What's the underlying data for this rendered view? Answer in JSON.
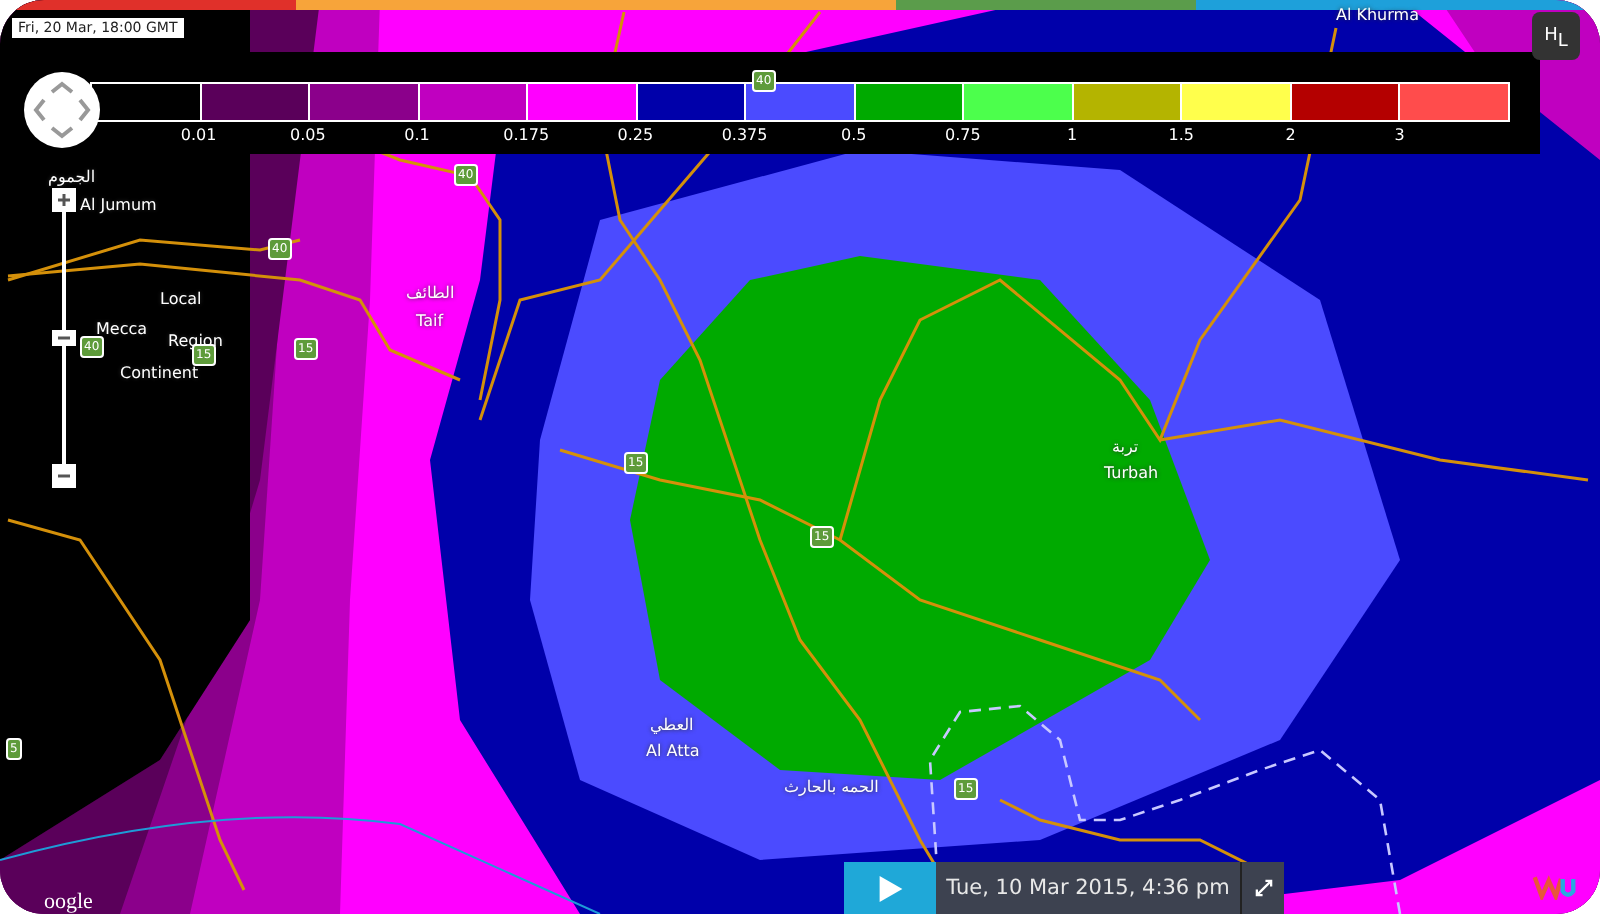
{
  "timestamp": "Fri, 20 Mar, 18:00 GMT",
  "legend": {
    "swatches": [
      {
        "color": "#000000"
      },
      {
        "color": "#5a005a"
      },
      {
        "color": "#8b008b"
      },
      {
        "color": "#c000c0"
      },
      {
        "color": "#ff00ff"
      },
      {
        "color": "#0000aa"
      },
      {
        "color": "#4b4bff"
      },
      {
        "color": "#00aa00"
      },
      {
        "color": "#4cff4c"
      },
      {
        "color": "#b4b400"
      },
      {
        "color": "#ffff4c"
      },
      {
        "color": "#b40000"
      },
      {
        "color": "#ff4c4c"
      }
    ],
    "labels": [
      "0.01",
      "0.05",
      "0.1",
      "0.175",
      "0.25",
      "0.375",
      "0.5",
      "0.75",
      "1",
      "1.5",
      "2",
      "3"
    ]
  },
  "place_labels": [
    {
      "text": "Al Khurma"
    },
    {
      "text": "الطائف"
    },
    {
      "text": "Taif"
    },
    {
      "text": "الجموم"
    },
    {
      "text": "Al Jumum"
    },
    {
      "text": "Local"
    },
    {
      "text": "Mecca"
    },
    {
      "text": "Region"
    },
    {
      "text": "Continent"
    },
    {
      "text": "تربة"
    },
    {
      "text": "Turbah"
    },
    {
      "text": "العطي"
    },
    {
      "text": "Al Atta"
    },
    {
      "text": "الحمه بالحارث"
    }
  ],
  "road_shields": [
    {
      "number": "40"
    },
    {
      "number": "40"
    },
    {
      "number": "40"
    },
    {
      "number": "40"
    },
    {
      "number": "15"
    },
    {
      "number": "15"
    },
    {
      "number": "15"
    },
    {
      "number": "15"
    },
    {
      "number": "15"
    },
    {
      "number": "5"
    }
  ],
  "zoom_slider": {
    "level": 0.5
  },
  "layer_button": {
    "labels": [
      "H",
      "L"
    ]
  },
  "playback": {
    "date": "Tue, 10 Mar 2015, 4:36 pm"
  },
  "attribution": "oogle"
}
